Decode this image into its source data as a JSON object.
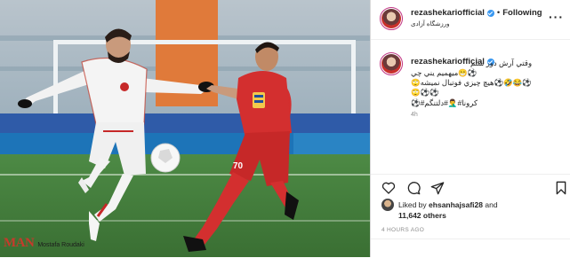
{
  "post": {
    "username": "rezashekariofficial",
    "follow_state": "Following",
    "separator": "•",
    "location": "ورزشگاه آزادی",
    "more_icon": "more-horizontal-icon"
  },
  "caption": {
    "username": "rezashekariofficial",
    "lines": [
      "وقتي آرش دور شتم",
      "⚽😁ميهميم يني چي",
      "⚽😂🤣⚽هيچ چيزي فوتبال نميشه🙄",
      "⚽⚽🙄",
      "کرونا#🤦‍♂️#دلتنگم#⚽"
    ],
    "time_ago": "4h"
  },
  "actions": {
    "like_icon": "heart-icon",
    "comment_icon": "comment-icon",
    "share_icon": "share-icon",
    "save_icon": "bookmark-icon"
  },
  "likes": {
    "prefix": "Liked by",
    "user": "ehsanhajsafi28",
    "and": "and",
    "count": "11,642 others"
  },
  "timestamp": "4 HOURS AGO",
  "photo": {
    "watermark_logo": "MAN",
    "credit": "Mostafa Roudaki",
    "jersey_number": "70"
  },
  "colors": {
    "verified": "#3897f0",
    "red_kit": "#d32f2f",
    "white_kit": "#f2f2f2",
    "pitch": "#3f7a3a"
  }
}
